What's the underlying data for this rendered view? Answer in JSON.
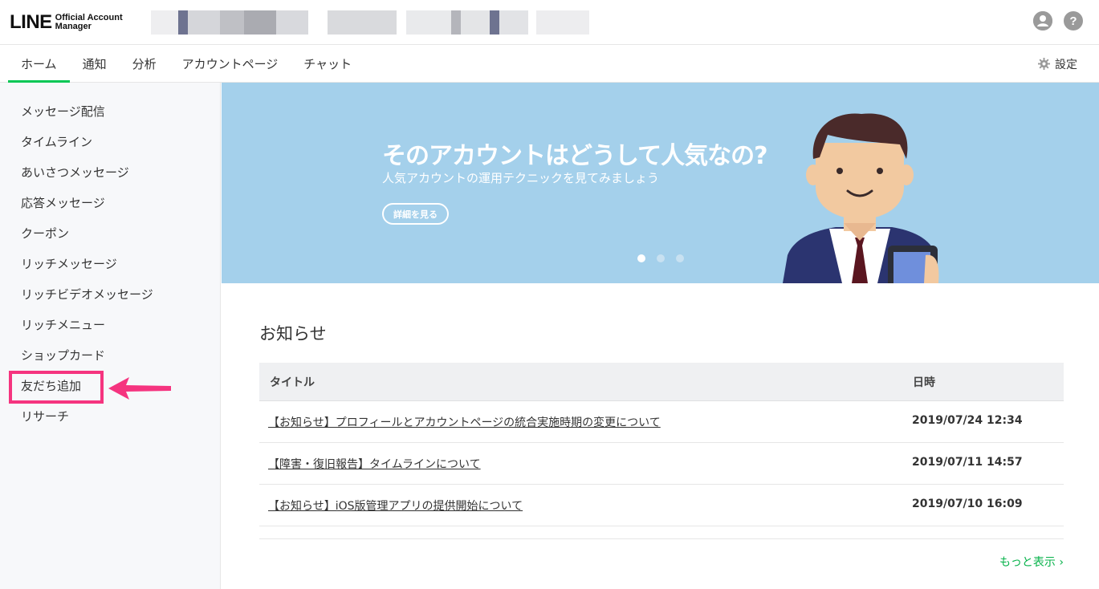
{
  "header": {
    "logo_main": "LINE",
    "logo_sub_1": "Official Account",
    "logo_sub_2": "Manager",
    "account_icon": "account-icon",
    "help_label": "?"
  },
  "nav": {
    "tabs": [
      {
        "label": "ホーム"
      },
      {
        "label": "通知"
      },
      {
        "label": "分析"
      },
      {
        "label": "アカウントページ"
      },
      {
        "label": "チャット"
      }
    ],
    "settings_label": "設定"
  },
  "sidebar": {
    "items": [
      {
        "label": "メッセージ配信"
      },
      {
        "label": "タイムライン"
      },
      {
        "label": "あいさつメッセージ"
      },
      {
        "label": "応答メッセージ"
      },
      {
        "label": "クーポン"
      },
      {
        "label": "リッチメッセージ"
      },
      {
        "label": "リッチビデオメッセージ"
      },
      {
        "label": "リッチメニュー"
      },
      {
        "label": "ショップカード"
      },
      {
        "label": "友だち追加"
      },
      {
        "label": "リサーチ"
      }
    ]
  },
  "banner": {
    "title": "そのアカウントはどうして人気なの?",
    "subtitle": "人気アカウントの運用テクニックを見てみましょう",
    "button_label": "詳細を見る"
  },
  "notices": {
    "heading": "お知らせ",
    "col_title": "タイトル",
    "col_date": "日時",
    "rows": [
      {
        "title": "【お知らせ】プロフィールとアカウントページの統合実施時期の変更について",
        "date": "2019/07/24 12:34"
      },
      {
        "title": "【障害・復旧報告】タイムラインについて",
        "date": "2019/07/11 14:57"
      },
      {
        "title": "【お知らせ】iOS版管理アプリの提供開始について",
        "date": "2019/07/10 16:09"
      }
    ],
    "more_label": "もっと表示"
  },
  "colors": {
    "accent_green": "#06c755",
    "banner_blue": "#a4d0eb",
    "highlight_pink": "#f5347f"
  }
}
